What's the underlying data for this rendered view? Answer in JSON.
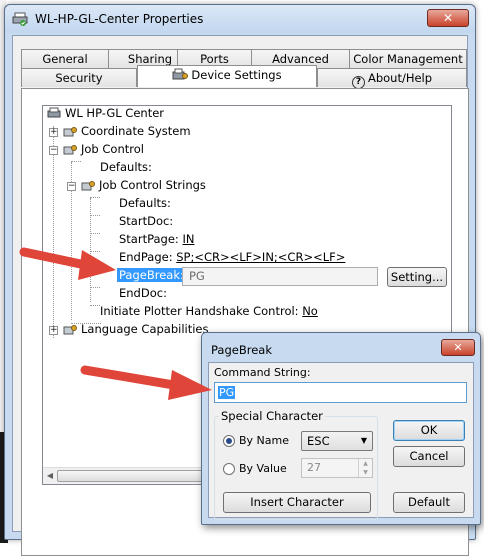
{
  "window": {
    "title": "WL-HP-GL-Center Properties",
    "close_glyph": "✕"
  },
  "tabs_row1": [
    "General",
    "Sharing",
    "Ports",
    "Advanced",
    "Color Management"
  ],
  "tabs_row2": [
    "Security",
    "Device Settings",
    "About/Help"
  ],
  "active_tab": "Device Settings",
  "tree": {
    "root": "WL HP-GL Center",
    "coordinate_system": "Coordinate System",
    "job_control": "Job Control",
    "defaults": "Defaults:",
    "job_control_strings": "Job Control Strings",
    "jcs_defaults": "Defaults:",
    "startdoc": "StartDoc:",
    "startpage_label": "StartPage:",
    "startpage_value": "IN",
    "endpage_label": "EndPage:",
    "endpage_value": "SP;<CR><LF>IN;<CR><LF>",
    "pagebreak_label": "PageBreak:",
    "pagebreak_value": "PG",
    "setting_button": "Setting...",
    "enddoc": "EndDoc:",
    "handshake_label": "Initiate Plotter Handshake Control:",
    "handshake_value": "No",
    "language_capabilities": "Language Capabilities"
  },
  "dialog": {
    "title": "PageBreak",
    "close_glyph": "✕",
    "command_label": "Command String:",
    "command_value": "PG",
    "group_label": "Special Character",
    "by_name": "By Name",
    "by_name_value": "ESC",
    "by_value": "By Value",
    "by_value_value": "27",
    "insert_button": "Insert Character",
    "ok_button": "OK",
    "cancel_button": "Cancel",
    "default_button": "Default",
    "selected_mode": "By Name"
  },
  "colors": {
    "accent_arrow": "#e0453a",
    "selection": "#3399ff",
    "frame": "#c7daf0"
  }
}
